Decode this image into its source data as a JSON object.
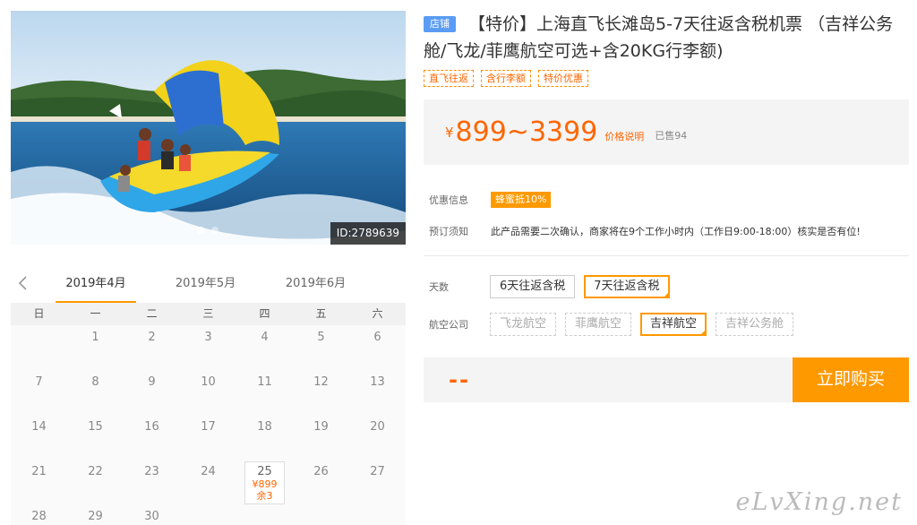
{
  "hero": {
    "id_badge": "ID:2789639",
    "image_alt": "banana boat ride on sea",
    "slide_count": 2,
    "active_slide": 1
  },
  "calendar": {
    "months": [
      "2019年4月",
      "2019年5月",
      "2019年6月"
    ],
    "active_month": "2019年4月",
    "weekdays": [
      "日",
      "一",
      "二",
      "三",
      "四",
      "五",
      "六"
    ],
    "weeks": [
      [
        {
          "d": ""
        },
        {
          "d": "1"
        },
        {
          "d": "2"
        },
        {
          "d": "3"
        },
        {
          "d": "4"
        },
        {
          "d": "5"
        },
        {
          "d": "6"
        }
      ],
      [
        {
          "d": "7"
        },
        {
          "d": "8"
        },
        {
          "d": "9"
        },
        {
          "d": "10"
        },
        {
          "d": "11"
        },
        {
          "d": "12"
        },
        {
          "d": "13"
        }
      ],
      [
        {
          "d": "14"
        },
        {
          "d": "15"
        },
        {
          "d": "16"
        },
        {
          "d": "17"
        },
        {
          "d": "18"
        },
        {
          "d": "19"
        },
        {
          "d": "20"
        }
      ],
      [
        {
          "d": "21"
        },
        {
          "d": "22"
        },
        {
          "d": "23"
        },
        {
          "d": "24"
        },
        {
          "d": "25",
          "price": "¥899",
          "stock": "余3"
        },
        {
          "d": "26"
        },
        {
          "d": "27"
        }
      ],
      [
        {
          "d": "28"
        },
        {
          "d": "29"
        },
        {
          "d": "30"
        },
        {
          "d": ""
        },
        {
          "d": ""
        },
        {
          "d": ""
        },
        {
          "d": ""
        }
      ]
    ]
  },
  "product": {
    "store_badge": "店铺",
    "title": "【特价】上海直飞长滩岛5-7天往返含税机票 （吉祥公务舱/飞龙/菲鹰航空可选+含20KG行李额)",
    "tags": [
      "直飞往返",
      "含行李额",
      "特价优惠"
    ],
    "yen": "¥",
    "price_range": "899~3399",
    "price_note": "价格说明",
    "sold": "已售94",
    "promo_label": "优惠信息",
    "promo_badge": "蜂蜜抵10%",
    "notice_label": "预订须知",
    "notice_text": "此产品需要二次确认，商家将在9个工作小时内（工作日9:00-18:00）核实是否有位!",
    "days_label": "天数",
    "days_options": [
      {
        "label": "6天往返含税",
        "state": "normal"
      },
      {
        "label": "7天往返含税",
        "state": "selected"
      }
    ],
    "airline_label": "航空公司",
    "airline_options": [
      {
        "label": "飞龙航空",
        "state": "disabled"
      },
      {
        "label": "菲鹰航空",
        "state": "disabled"
      },
      {
        "label": "吉祥航空",
        "state": "selected"
      },
      {
        "label": "吉祥公务舱",
        "state": "disabled"
      }
    ],
    "total_placeholder": "--",
    "buy_label": "立即购买"
  },
  "watermark": "eLvXing.net",
  "colors": {
    "accent": "#ff9900",
    "price": "#ff6600",
    "store_badge": "#5a9cf5"
  }
}
